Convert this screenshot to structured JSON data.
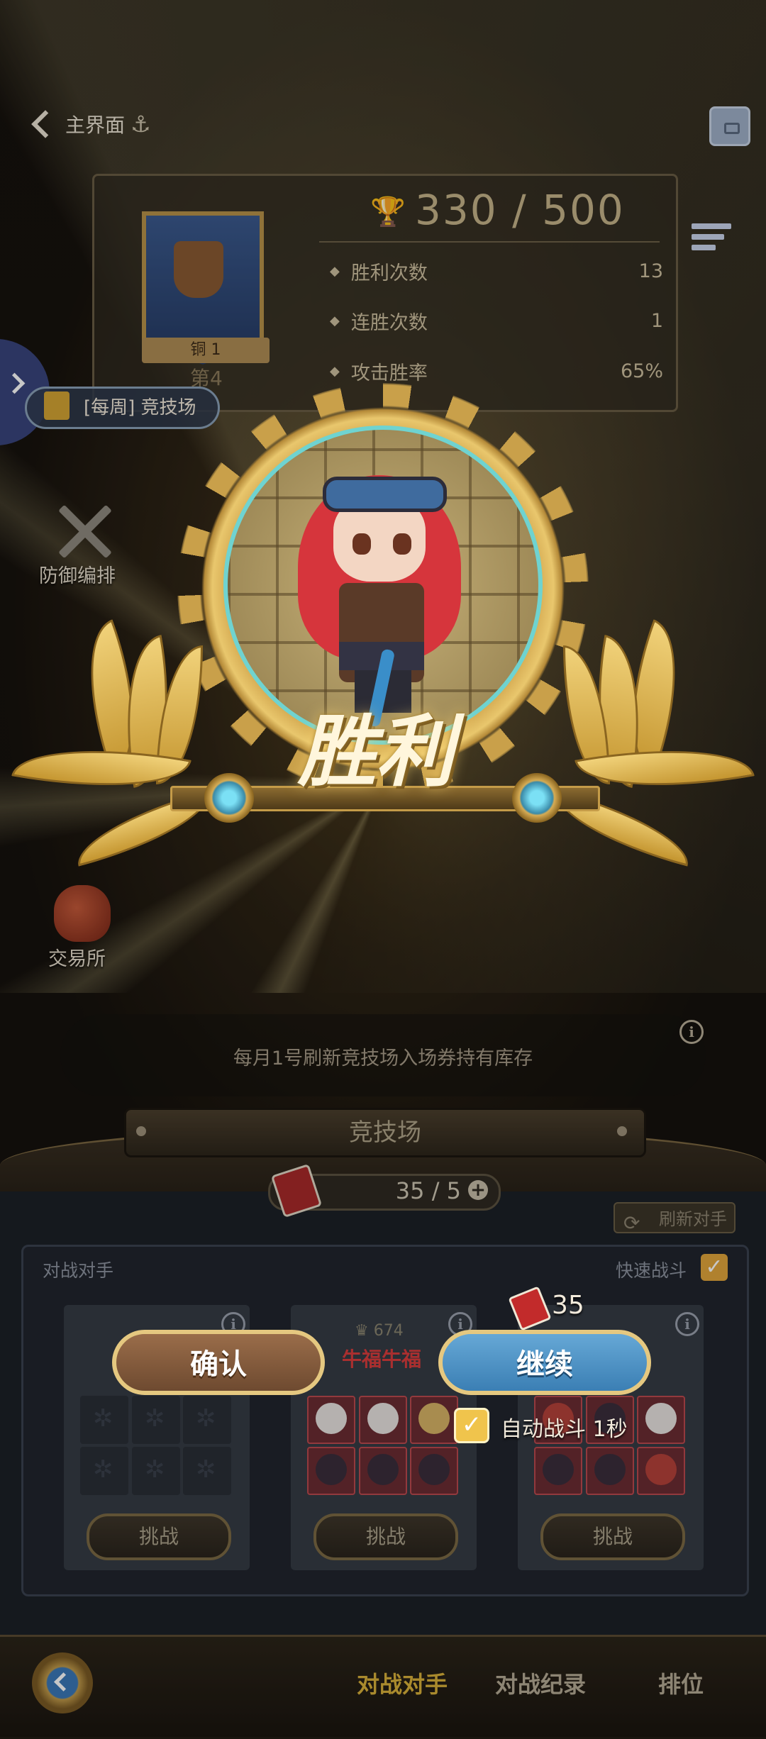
{
  "top": {
    "back_label": "主界面",
    "anchor_icon": "⚓"
  },
  "rank": {
    "tier": "铜 1",
    "position": "第4",
    "score": "330 / 500",
    "stats": [
      {
        "label": "胜利次数",
        "value": "13"
      },
      {
        "label": "连胜次数",
        "value": "1"
      },
      {
        "label": "攻击胜率",
        "value": "65%"
      }
    ]
  },
  "side": {
    "weekly_quest": "[每周] 竞技场",
    "defense_lineup": "防御编排",
    "exchange": "交易所"
  },
  "victory": {
    "title": "胜利"
  },
  "arena": {
    "refresh_note": "每月1号刷新竞技场入场券持有库存",
    "title": "竞技场",
    "tickets": "35 / 5",
    "refresh_opponents": "刷新对手",
    "opponents_header": "对战对手",
    "quick_battle": "快速战斗",
    "opponents": [
      {
        "power": "",
        "name": "",
        "challenge": "挑战"
      },
      {
        "power": "674",
        "name": "牛福牛福",
        "challenge": "挑战"
      },
      {
        "power": "",
        "name": "",
        "challenge": "挑战"
      }
    ]
  },
  "dialog": {
    "confirm": "确认",
    "continue": "继续",
    "cost": "35",
    "auto_battle": "自动战斗 1秒"
  },
  "nav": {
    "tabs": [
      "对战对手",
      "对战纪录",
      "排位"
    ],
    "active_color": "#d9b13a",
    "inactive_color": "#b5ab95"
  }
}
